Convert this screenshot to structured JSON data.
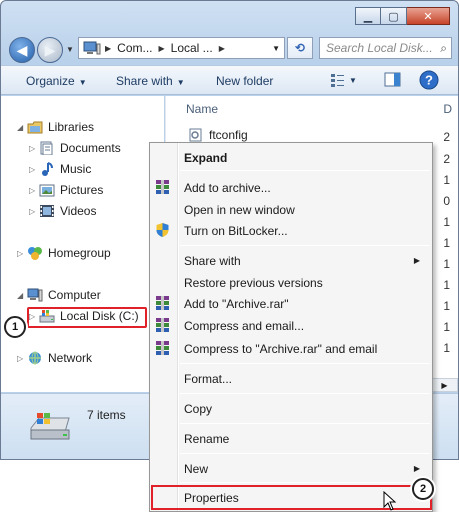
{
  "address": {
    "segments": [
      "Com...",
      "Local ..."
    ],
    "search_placeholder": "Search Local Disk..."
  },
  "toolbar": {
    "organize": "Organize",
    "share_with": "Share with",
    "new_folder": "New folder"
  },
  "nav": {
    "libraries": "Libraries",
    "documents": "Documents",
    "music": "Music",
    "pictures": "Pictures",
    "videos": "Videos",
    "homegroup": "Homegroup",
    "computer": "Computer",
    "local_disk": "Local Disk (C:)",
    "network": "Network"
  },
  "content": {
    "col_name": "Name",
    "col_d": "D",
    "file_name": "ftconfig",
    "row_digits": [
      "2",
      "2",
      "1",
      "0",
      "1",
      "1",
      "1",
      "1",
      "1",
      "1",
      "1"
    ]
  },
  "details": {
    "item_count": "7 items"
  },
  "menu": {
    "expand": "Expand",
    "add_to_archive": "Add to archive...",
    "open_new_window": "Open in new window",
    "bitlocker": "Turn on BitLocker...",
    "share_with": "Share with",
    "restore": "Restore previous versions",
    "add_to_archive_rar": "Add to \"Archive.rar\"",
    "compress_email": "Compress and email...",
    "compress_to_rar_email": "Compress to \"Archive.rar\" and email",
    "format": "Format...",
    "copy": "Copy",
    "rename": "Rename",
    "new": "New",
    "properties": "Properties"
  },
  "callouts": {
    "step1": "1",
    "step2": "2"
  },
  "colors": {
    "highlight": "#e0212a",
    "accent": "#245ea8"
  },
  "icons": [
    "back-arrow-icon",
    "forward-arrow-icon",
    "computer-icon",
    "refresh-icon",
    "search-icon",
    "views-icon",
    "preview-pane-icon",
    "help-icon",
    "libraries-icon",
    "documents-icon",
    "music-icon",
    "pictures-icon",
    "videos-icon",
    "homegroup-icon",
    "computer-icon",
    "drive-icon",
    "network-icon",
    "rar-icon",
    "shield-icon",
    "cursor-icon"
  ]
}
